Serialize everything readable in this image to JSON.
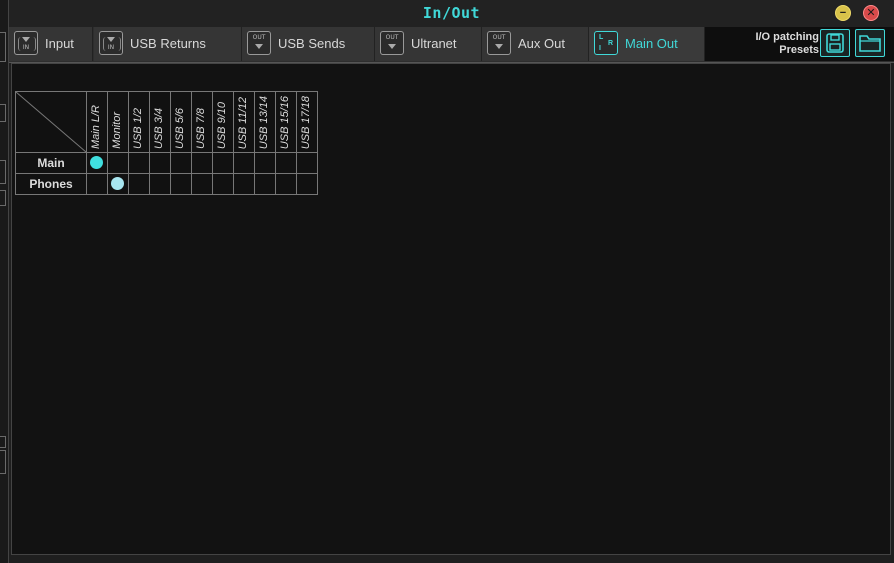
{
  "window": {
    "title": "In/Out"
  },
  "tabs": [
    {
      "label": "Input",
      "icon": "input-icon",
      "icon_text": "IN"
    },
    {
      "label": "USB Returns",
      "icon": "usb-returns-icon",
      "icon_text": "IN"
    },
    {
      "label": "USB Sends",
      "icon": "usb-sends-icon",
      "icon_text": "OUT"
    },
    {
      "label": "Ultranet",
      "icon": "ultranet-icon",
      "icon_text": "OUT"
    },
    {
      "label": "Aux Out",
      "icon": "aux-out-icon",
      "icon_text": "OUT"
    },
    {
      "label": "Main Out",
      "icon": "main-out-icon",
      "icon_text": ""
    }
  ],
  "presets": {
    "label_line1": "I/O patching",
    "label_line2": "Presets",
    "save_icon": "save-icon",
    "load_icon": "folder-icon"
  },
  "matrix": {
    "columns": [
      "Main L/R",
      "Monitor",
      "USB 1/2",
      "USB 3/4",
      "USB 5/6",
      "USB 7/8",
      "USB 9/10",
      "USB 11/12",
      "USB 13/14",
      "USB 15/16",
      "USB 17/18"
    ],
    "rows": [
      {
        "label": "Main",
        "selected": 0
      },
      {
        "label": "Phones",
        "selected": 1
      }
    ],
    "colors": {
      "main_dot": "#40e0e0",
      "phones_dot": "#a8e6f0",
      "accent": "#40d8d8"
    }
  }
}
